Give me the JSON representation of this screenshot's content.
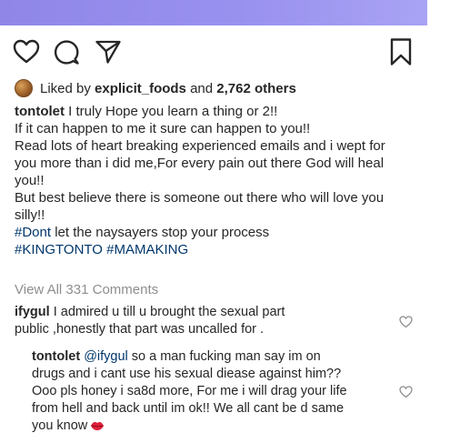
{
  "post": {
    "likes": {
      "prefix": "Liked by",
      "liker": "explicit_foods",
      "conjunction": "and",
      "others": "2,762 others"
    },
    "caption": {
      "username": "tontolet",
      "lines": [
        "I truly Hope you learn a thing or 2!!",
        "If it can happen to me it sure can happen to you!!",
        "Read lots of heart breaking experienced emails and i wept for",
        "you more than i did me,For every pain out there God will heal",
        "you!!",
        "But best believe there is someone out there who will love you",
        "silly!!"
      ],
      "hashtag_line_1": {
        "tag": "#Dont",
        "rest": "let the naysayers stop your process"
      },
      "hashtag_line_2": [
        "#KINGTONTO",
        "#MAMAKING"
      ]
    },
    "view_all_comments": "View All 331 Comments",
    "comments": [
      {
        "username": "ifygul",
        "lines": [
          "I admired u till u brought the sexual part",
          "public ,honestly that part was uncalled for ."
        ]
      },
      {
        "username": "tontolet",
        "mention": "@ifygul",
        "first_line_rest": "so a man fucking man say im on",
        "lines": [
          "drugs and i cant use his sexual diease against him??",
          "Ooo pls honey i sa8d more, For me i will drag your life",
          "from hell and back until im ok!! We all cant be d same",
          "you know"
        ],
        "emoji": "kiss-lips-icon"
      }
    ]
  },
  "colors": {
    "header_gradient_start": "#8f86e8",
    "text": "#262626",
    "muted": "#8e8e8e",
    "hashtag": "#00376b",
    "lips": "#e0203a"
  }
}
